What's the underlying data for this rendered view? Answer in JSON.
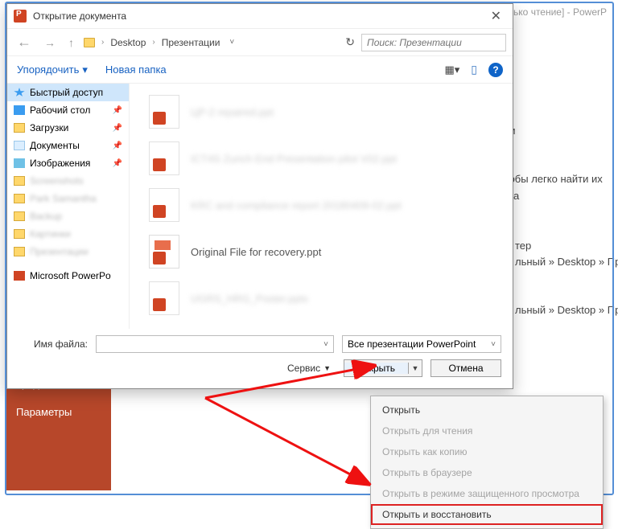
{
  "bg": {
    "title_right": "ько чтение]  -  PowerP",
    "sidebar": {
      "item1": "предложения",
      "item2": "Параметры"
    },
    "panel_hdr": "лки",
    "panel_l1": "чтобы легко найти их",
    "panel_l2": "и на",
    "path_hdr": "тер",
    "path1": "льный » Desktop » Пр",
    "path2": "льный » Desktop » Пр"
  },
  "dialog": {
    "title": "Открытие документа",
    "nav": {
      "seg1": "Desktop",
      "seg2": "Презентации"
    },
    "search_placeholder": "Поиск: Презентации",
    "organize": "Упорядочить",
    "newfolder": "Новая папка"
  },
  "tree": {
    "quick": "Быстрый доступ",
    "desktop": "Рабочий стол",
    "downloads": "Загрузки",
    "documents": "Документы",
    "pictures": "Изображения",
    "b1": "Screenshots",
    "b2": "Park Samantha",
    "b3": "Backup",
    "b4": "Картинки",
    "b5": "Презентации",
    "pp": "Microsoft PowerPo"
  },
  "files": {
    "f1": "ЦР-2 repaired.ppt",
    "f2": "ICT4S Zurich End Presentation pilot V02.ppt",
    "f3": "KRC and compliance report 20180409-02.ppt",
    "f4": "Original File for recovery.ppt",
    "f5": "UGRS_HRG_Poster.pptx"
  },
  "footer": {
    "fname_label": "Имя файла:",
    "ftype": "Все презентации PowerPoint",
    "service": "Сервис",
    "open": "Открыть",
    "cancel": "Отмена"
  },
  "menu": {
    "m1": "Открыть",
    "m2": "Открыть для чтения",
    "m3": "Открыть как копию",
    "m4": "Открыть в браузере",
    "m5": "Открыть в режиме защищенного просмотра",
    "m6": "Открыть и восстановить"
  }
}
